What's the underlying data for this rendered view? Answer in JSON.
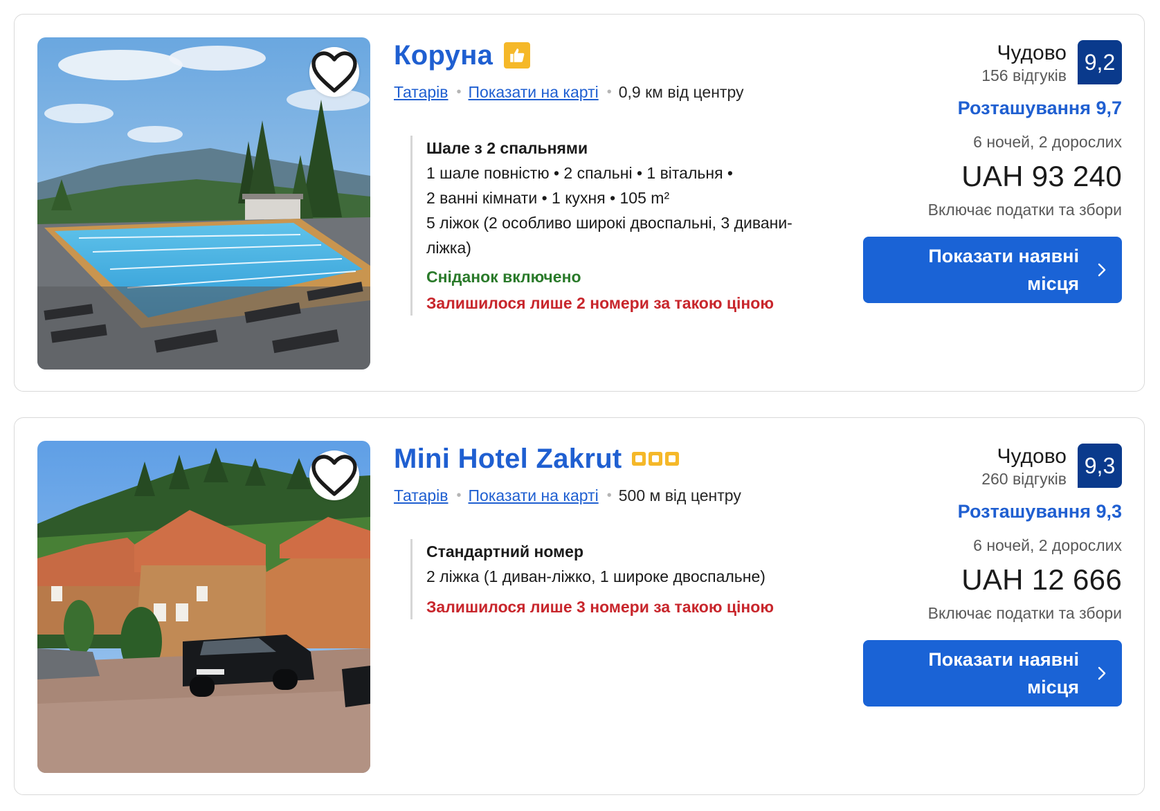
{
  "listings": [
    {
      "name": "Коруна",
      "badge": "thumbs-up-icon",
      "city": "Татарів",
      "map_link": "Показати на карті",
      "distance": "0,9 км від центру",
      "room_name": "Шале з 2 спальнями",
      "room_details": [
        "1 шале повністю • 2 спальні • 1 вітальня •",
        "2 ванні кімнати • 1 кухня • 105 m²",
        "5 ліжок (2 особливо широкі двоспальні, 3 дивани-",
        "ліжка)"
      ],
      "breakfast": "Сніданок включено",
      "scarcity": "Залишилося лише 2 номери за такою ціною",
      "rating_word": "Чудово",
      "reviews": "156 відгуків",
      "score": "9,2",
      "location_score": "Розташування 9,7",
      "stay": "6 ночей, 2 дорослих",
      "price": "UAH 93 240",
      "taxes": "Включає податки та збори",
      "cta_line1": "Показати наявні",
      "cta_line2": "місця"
    },
    {
      "name": "Mini Hotel Zakrut",
      "stars": 3,
      "city": "Татарів",
      "map_link": "Показати на карті",
      "distance": "500 м від центру",
      "room_name": "Стандартний номер",
      "room_details": [
        "2 ліжка (1 диван-ліжко, 1 широке двоспальне)"
      ],
      "scarcity": "Залишилося лише 3 номери за такою ціною",
      "rating_word": "Чудово",
      "reviews": "260 відгуків",
      "score": "9,3",
      "location_score": "Розташування 9,3",
      "stay": "6 ночей, 2 дорослих",
      "price": "UAH 12 666",
      "taxes": "Включає податки та збори",
      "cta_line1": "Показати наявні",
      "cta_line2": "місця"
    }
  ],
  "colors": {
    "link_blue": "#1f5fd1",
    "score_navy": "#0a3a8c",
    "cta_blue": "#1a63d6",
    "breakfast_green": "#2a7a2a",
    "scarcity_red": "#c8262c",
    "badge_yellow": "#f5b829"
  }
}
